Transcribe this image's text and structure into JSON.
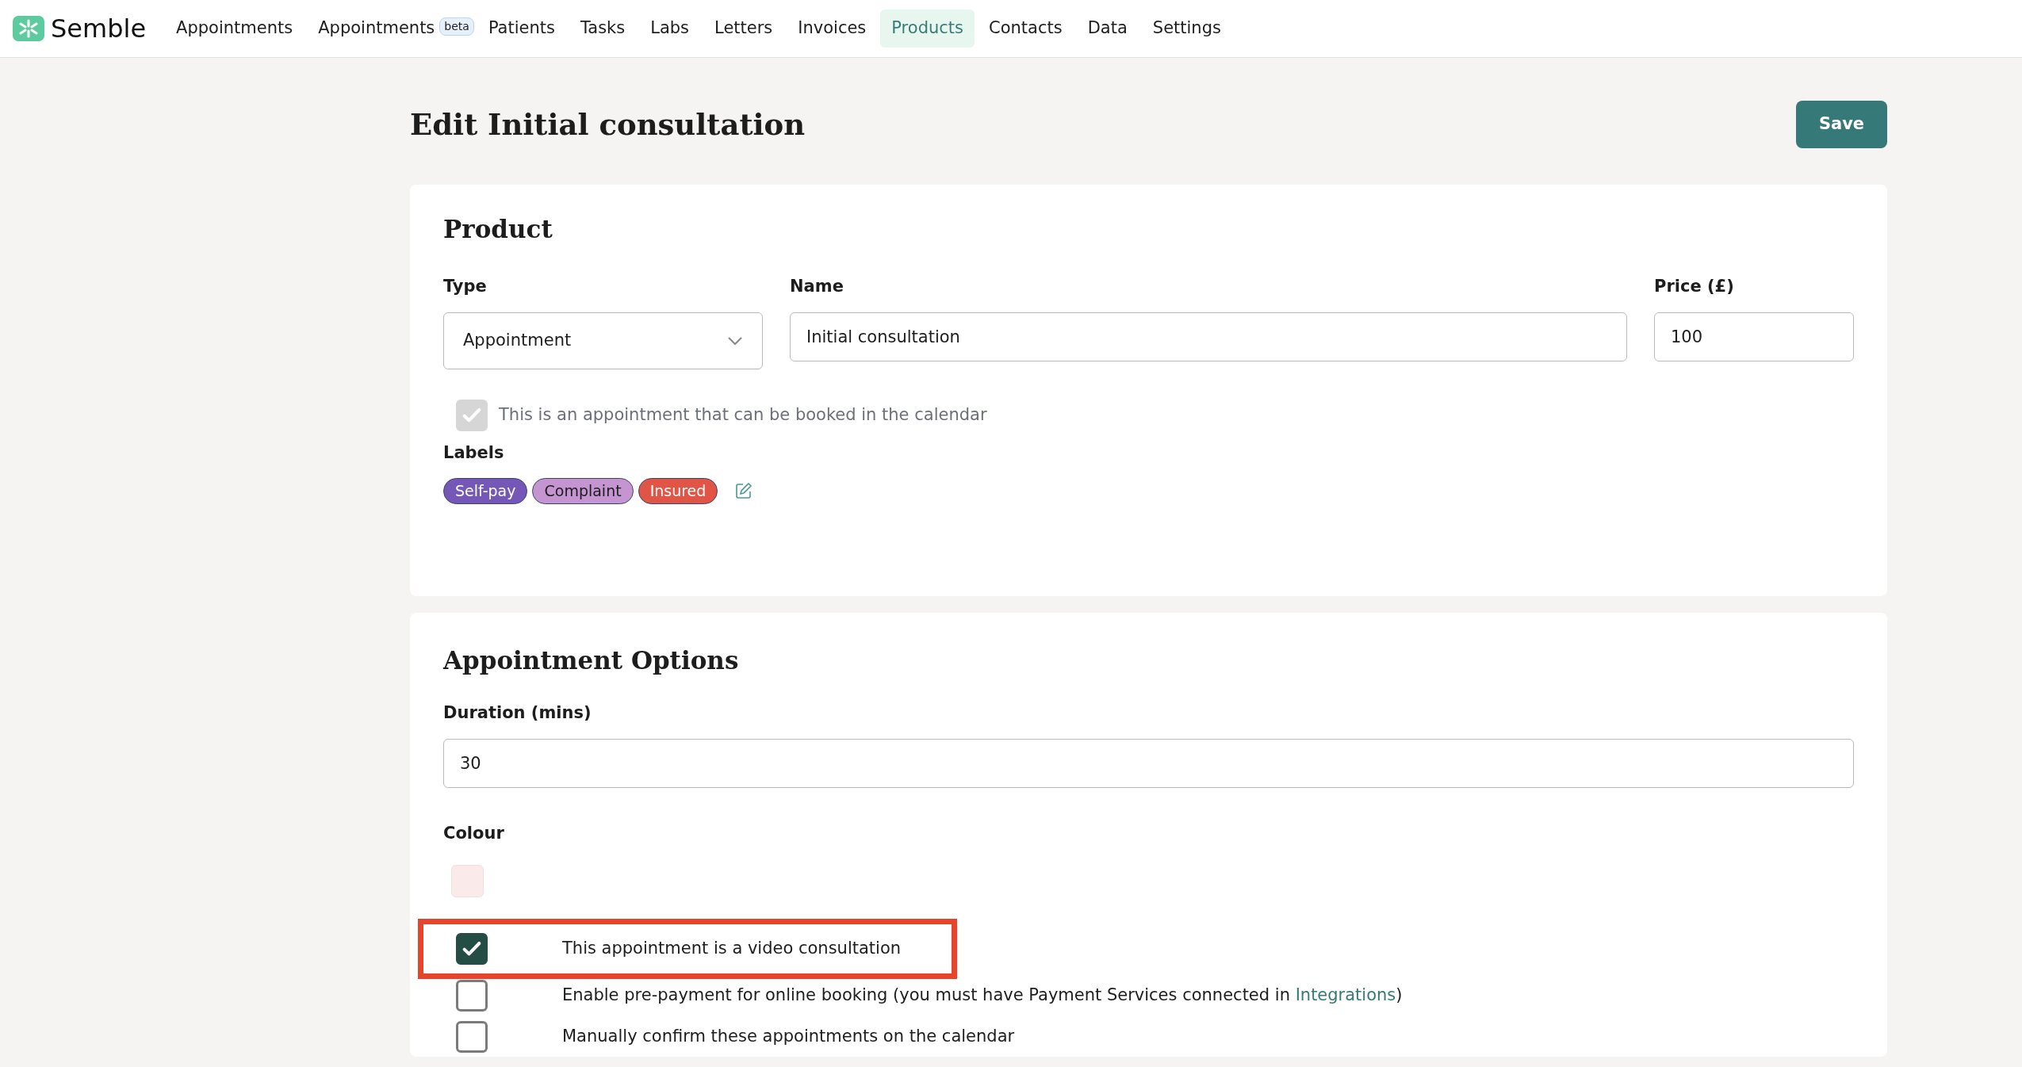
{
  "brand": {
    "name": "Semble"
  },
  "nav": [
    {
      "label": "Appointments",
      "selected": false
    },
    {
      "label": "Appointments",
      "badge": "beta",
      "selected": false
    },
    {
      "label": "Patients",
      "selected": false
    },
    {
      "label": "Tasks",
      "selected": false
    },
    {
      "label": "Labs",
      "selected": false
    },
    {
      "label": "Letters",
      "selected": false
    },
    {
      "label": "Invoices",
      "selected": false
    },
    {
      "label": "Products",
      "selected": true
    },
    {
      "label": "Contacts",
      "selected": false
    },
    {
      "label": "Data",
      "selected": false
    },
    {
      "label": "Settings",
      "selected": false
    }
  ],
  "page": {
    "title": "Edit Initial consultation",
    "save_button": "Save"
  },
  "product": {
    "title": "Product",
    "type": {
      "label": "Type",
      "value": "Appointment"
    },
    "name": {
      "label": "Name",
      "value": "Initial consultation"
    },
    "price": {
      "label": "Price (£)",
      "value": "100"
    },
    "bookable": {
      "label": "This is an appointment that can be booked in the calendar",
      "checked": true,
      "disabled": true
    },
    "labels_title": "Labels",
    "labels": [
      {
        "text": "Self-pay",
        "color": "#7457b7"
      },
      {
        "text": "Complaint",
        "color": "#c495d0"
      },
      {
        "text": "Insured",
        "color": "#e05545"
      }
    ]
  },
  "appointment_options": {
    "title": "Appointment Options",
    "duration": {
      "label": "Duration (mins)",
      "value": "30"
    },
    "colour": {
      "label": "Colour",
      "color": "#fbeaea"
    },
    "options": [
      {
        "text": "This appointment is a video consultation",
        "checked": true,
        "highlighted": true
      },
      {
        "text": "Enable pre-payment for online booking (you must have Payment Services connected in ",
        "link": "Integrations",
        "after": ")",
        "checked": false,
        "highlighted": false
      },
      {
        "text": "Manually confirm these appointments on the calendar",
        "checked": false,
        "highlighted": false
      }
    ]
  }
}
